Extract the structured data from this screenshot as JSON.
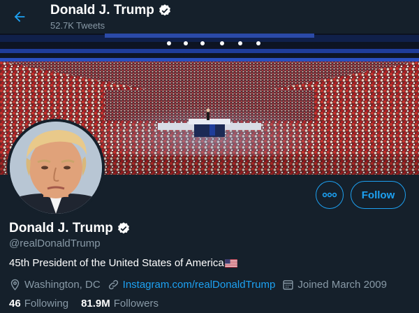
{
  "header": {
    "name": "Donald J. Trump",
    "tweet_count": "52.7K",
    "tweet_label": "Tweets",
    "back_icon": "arrow-left-icon"
  },
  "profile": {
    "name": "Donald J. Trump",
    "handle": "@realDonaldTrump",
    "bio": "45th President of the United States of America",
    "verified_icon": "verified-badge-icon",
    "location": "Washington, DC",
    "website": "Instagram.com/realDonaldTrump",
    "joined": "Joined March 2009"
  },
  "actions": {
    "more_icon": "more-options-icon",
    "follow_label": "Follow"
  },
  "stats": {
    "following_count": "46",
    "following_label": "Following",
    "followers_count": "81.9M",
    "followers_label": "Followers"
  },
  "colors": {
    "background": "#15202b",
    "accent": "#1da1f2",
    "secondary_text": "#8899a6"
  }
}
